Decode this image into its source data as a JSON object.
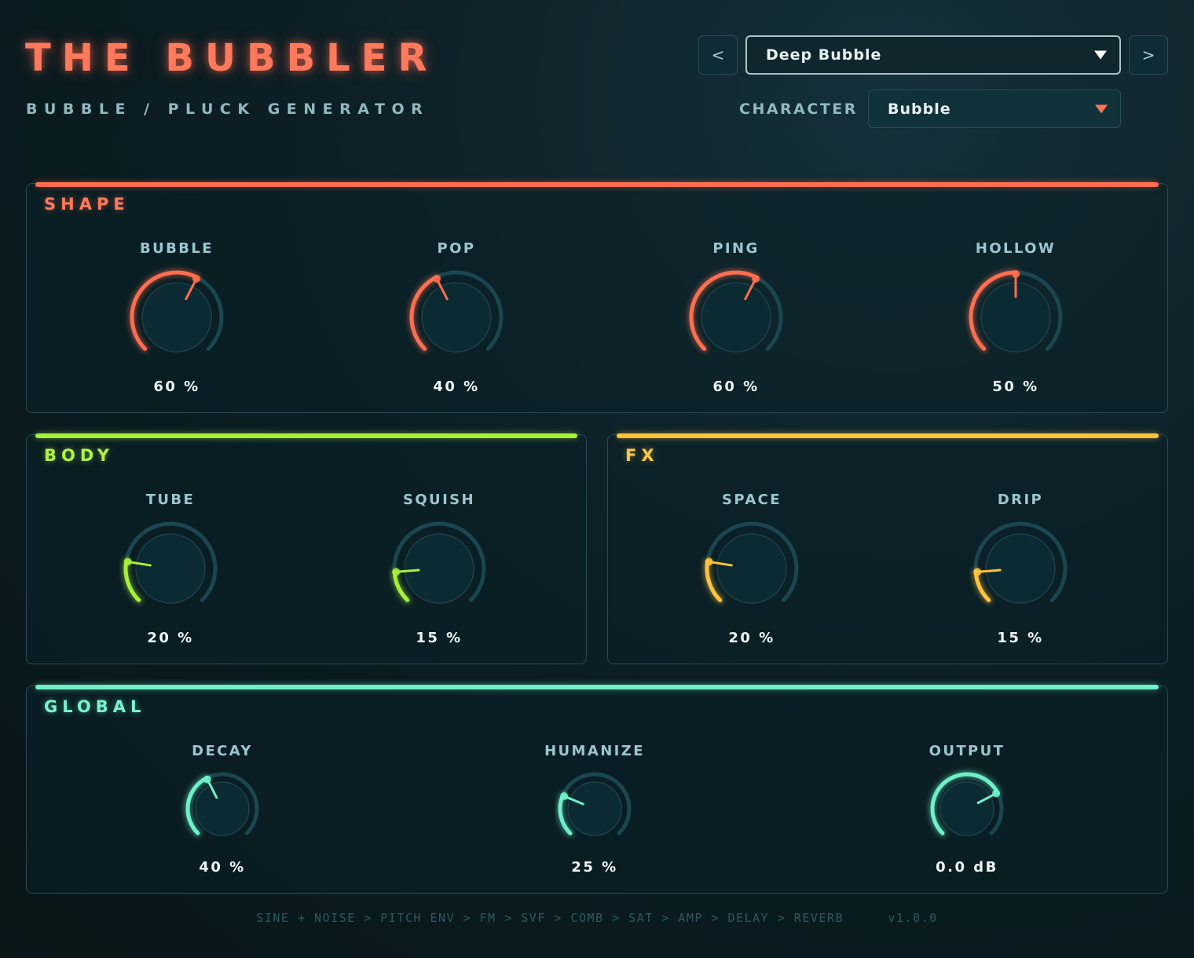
{
  "header": {
    "title": "THE BUBBLER",
    "subtitle": "BUBBLE / PLUCK GENERATOR",
    "prev_label": "<",
    "next_label": ">",
    "preset": "Deep Bubble",
    "character_label": "CHARACTER",
    "character": "Bubble"
  },
  "colors": {
    "shape": "#ff6e50",
    "body": "#a6f03a",
    "fx": "#ffc23c",
    "global": "#6ef0c8",
    "track": "#1b4650"
  },
  "panels": {
    "shape": {
      "title": "SHAPE",
      "knobs": [
        {
          "label": "BUBBLE",
          "value": "60 %",
          "level": 0.6
        },
        {
          "label": "POP",
          "value": "40 %",
          "level": 0.4
        },
        {
          "label": "PING",
          "value": "60 %",
          "level": 0.6
        },
        {
          "label": "HOLLOW",
          "value": "50 %",
          "level": 0.5
        }
      ]
    },
    "body": {
      "title": "BODY",
      "knobs": [
        {
          "label": "TUBE",
          "value": "20 %",
          "level": 0.2
        },
        {
          "label": "SQUISH",
          "value": "15 %",
          "level": 0.15
        }
      ]
    },
    "fx": {
      "title": "FX",
      "knobs": [
        {
          "label": "SPACE",
          "value": "20 %",
          "level": 0.2
        },
        {
          "label": "DRIP",
          "value": "15 %",
          "level": 0.15
        }
      ]
    },
    "global": {
      "title": "GLOBAL",
      "knobs": [
        {
          "label": "DECAY",
          "value": "40 %",
          "level": 0.4
        },
        {
          "label": "HUMANIZE",
          "value": "25 %",
          "level": 0.25
        },
        {
          "label": "OUTPUT",
          "value": "0.0 dB",
          "level": 0.73
        }
      ]
    }
  },
  "footer": {
    "chain": "SINE + NOISE > PITCH ENV > FM > SVF > COMB > SAT > AMP > DELAY > REVERB",
    "version": "v1.0.0"
  }
}
